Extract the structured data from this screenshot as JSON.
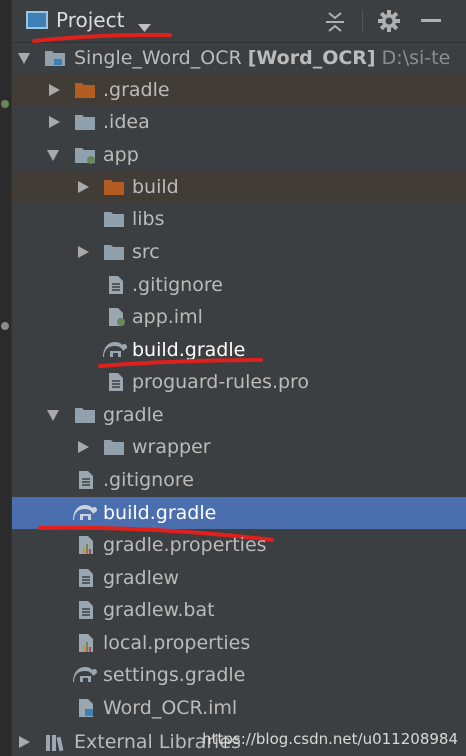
{
  "panel": {
    "view_label": "Project",
    "colors": {
      "background": "#3c3f41",
      "selection": "#4b6eaf",
      "highlight_row": "#413d36",
      "folder": "#90a0ad",
      "folder_excluded": "#b35d23",
      "annotation_red": "#e0201c"
    }
  },
  "tree": {
    "root_name": "Single_Word_OCR",
    "root_module": "[Word_OCR]",
    "root_path": "D:\\si-te",
    "items": [
      {
        "label": ".gradle",
        "icon": "folder-excluded-icon"
      },
      {
        "label": ".idea",
        "icon": "folder-icon"
      },
      {
        "label": "app",
        "icon": "module-folder-icon"
      },
      {
        "label": "build",
        "icon": "folder-excluded-icon"
      },
      {
        "label": "libs",
        "icon": "folder-icon"
      },
      {
        "label": "src",
        "icon": "folder-icon"
      },
      {
        "label": ".gitignore",
        "icon": "text-file-icon"
      },
      {
        "label": "app.iml",
        "icon": "module-file-icon"
      },
      {
        "label": "build.gradle",
        "icon": "gradle-icon"
      },
      {
        "label": "proguard-rules.pro",
        "icon": "text-file-icon"
      },
      {
        "label": "gradle",
        "icon": "folder-icon"
      },
      {
        "label": "wrapper",
        "icon": "folder-icon"
      },
      {
        "label": ".gitignore",
        "icon": "text-file-icon"
      },
      {
        "label": "build.gradle",
        "icon": "gradle-icon"
      },
      {
        "label": "gradle.properties",
        "icon": "properties-file-icon"
      },
      {
        "label": "gradlew",
        "icon": "text-file-icon"
      },
      {
        "label": "gradlew.bat",
        "icon": "text-file-icon"
      },
      {
        "label": "local.properties",
        "icon": "properties-file-icon"
      },
      {
        "label": "settings.gradle",
        "icon": "gradle-icon"
      },
      {
        "label": "Word_OCR.iml",
        "icon": "module-file-icon"
      }
    ],
    "external_libraries": "External Libraries"
  },
  "watermark": "https://blog.csdn.net/u011208984"
}
